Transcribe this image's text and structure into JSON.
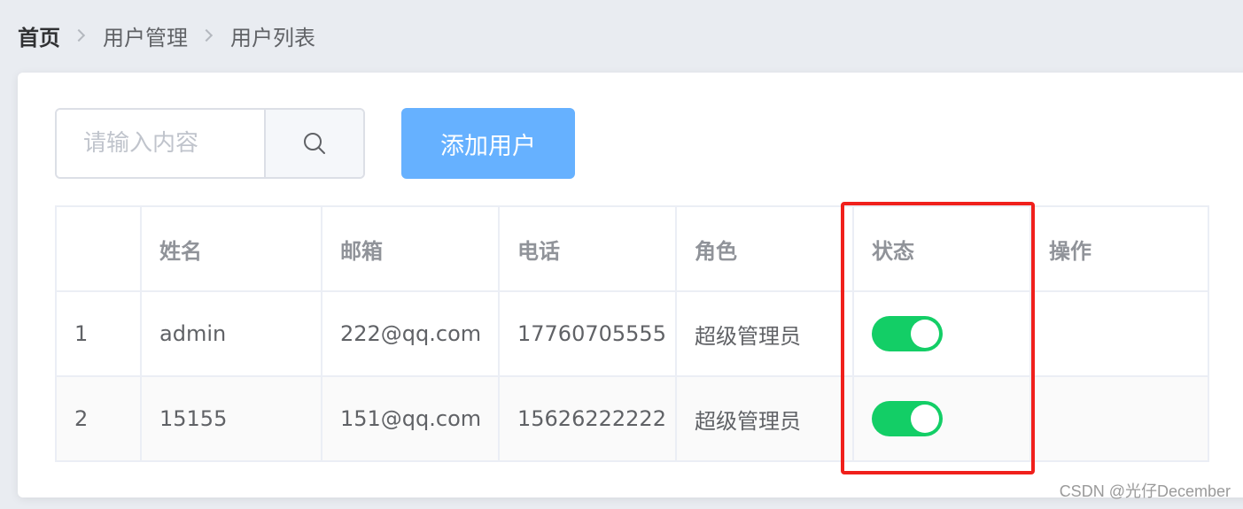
{
  "breadcrumb": {
    "items": [
      "首页",
      "用户管理",
      "用户列表"
    ]
  },
  "toolbar": {
    "search_placeholder": "请输入内容",
    "search_value": "",
    "search_icon": "search-icon",
    "add_user_label": "添加用户"
  },
  "table": {
    "headers": [
      "",
      "姓名",
      "邮箱",
      "电话",
      "角色",
      "状态",
      "操作"
    ],
    "rows": [
      {
        "index": "1",
        "name": "admin",
        "email": "222@qq.com",
        "phone": "17760705555",
        "role": "超级管理员",
        "status": true
      },
      {
        "index": "2",
        "name": "15155",
        "email": "151@qq.com",
        "phone": "15626222222",
        "role": "超级管理员",
        "status": true
      }
    ]
  },
  "colors": {
    "primary_light": "#66b1ff",
    "switch_on": "#13ce66",
    "highlight": "#f0201c",
    "background": "#e9ecf1"
  },
  "watermark": "CSDN @光仔December"
}
